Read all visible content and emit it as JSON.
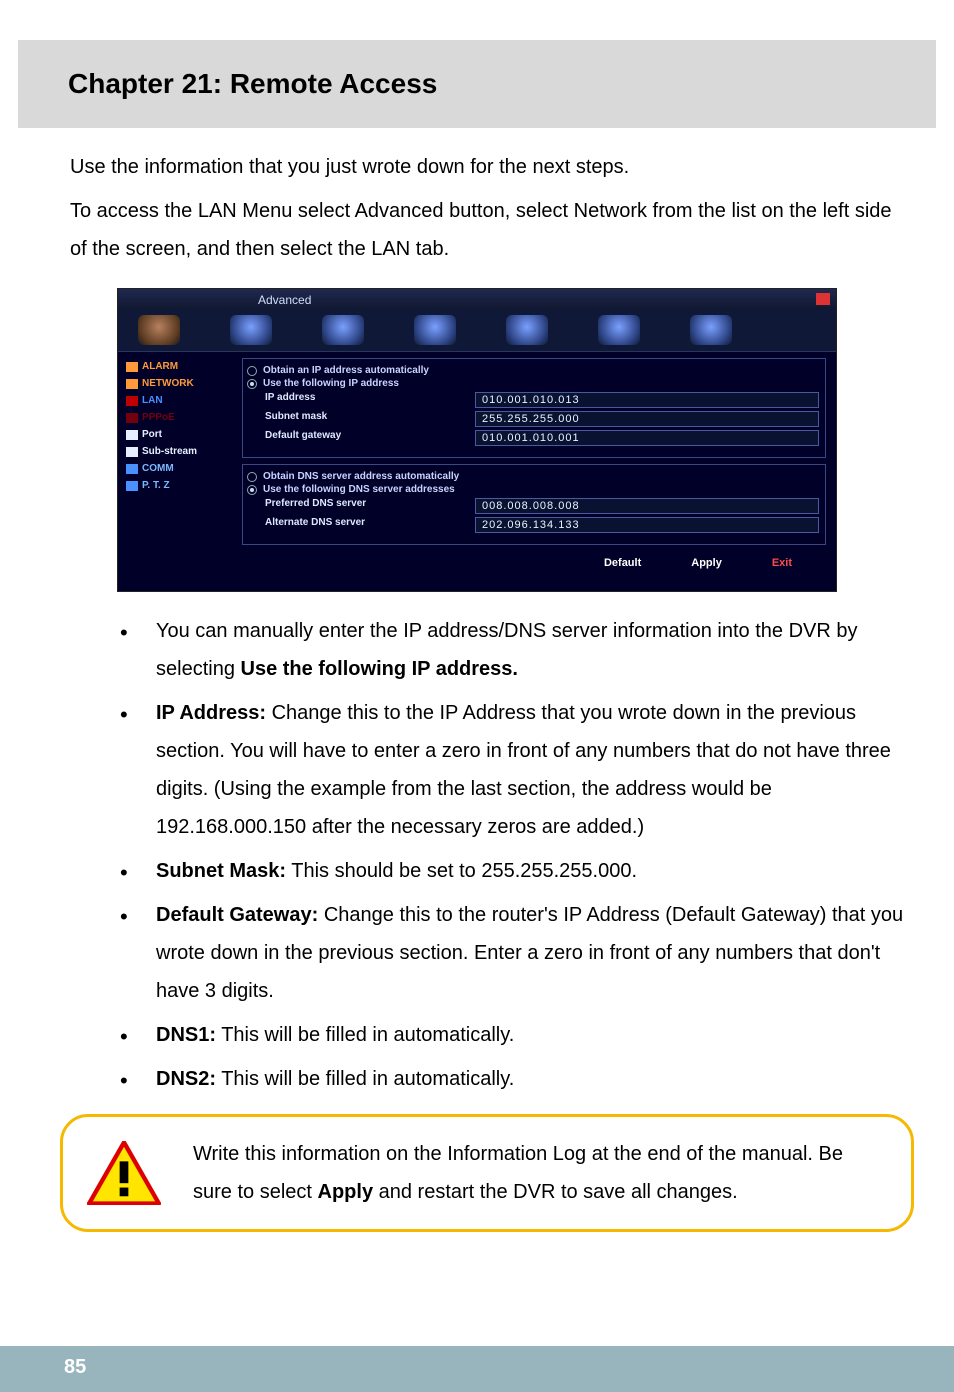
{
  "chapter_title": "Chapter 21: Remote Access",
  "intro": {
    "p1": "Use the information that you just wrote down for the next steps.",
    "p2": "To access the LAN Menu select Advanced button, select Network from the list on the left side of the screen, and then select the LAN tab."
  },
  "screenshot": {
    "window_title": "Advanced",
    "sidebar": {
      "items": [
        {
          "label": "ALARM"
        },
        {
          "label": "NETWORK"
        },
        {
          "label": "LAN"
        },
        {
          "label": "PPPoE"
        },
        {
          "label": "Port"
        },
        {
          "label": "Sub-stream"
        },
        {
          "label": "COMM"
        },
        {
          "label": "P. T. Z"
        }
      ]
    },
    "ip_section": {
      "radio_auto": "Obtain an IP address automatically",
      "radio_manual": "Use the following IP address",
      "rows": {
        "ip_label": "IP address",
        "ip_value": "010.001.010.013",
        "subnet_label": "Subnet mask",
        "subnet_value": "255.255.255.000",
        "gateway_label": "Default gateway",
        "gateway_value": "010.001.010.001"
      }
    },
    "dns_section": {
      "radio_auto": "Obtain DNS server address automatically",
      "radio_manual": "Use the following DNS server addresses",
      "rows": {
        "pref_label": "Preferred DNS server",
        "pref_value": "008.008.008.008",
        "alt_label": "Alternate DNS server",
        "alt_value": "202.096.134.133"
      }
    },
    "buttons": {
      "default": "Default",
      "apply": "Apply",
      "exit": "Exit"
    }
  },
  "bullets": {
    "b1_pre": "You can manually enter the IP address/DNS server information into the DVR by selecting ",
    "b1_bold": "Use the following IP address.",
    "b2_bold": "IP Address:",
    "b2_text": " Change this to the IP Address that you wrote down in the previous section. You will have to enter a zero in front of any numbers that do not have three digits. (Using the example from the last section, the address would be 192.168.000.150 after the necessary zeros are added.)",
    "b3_bold": "Subnet Mask:",
    "b3_text": " This should be set to 255.255.255.000.",
    "b4_bold": "Default Gateway:",
    "b4_text": " Change this to the router's IP Address (Default Gateway) that you wrote down in the previous section. Enter a zero in front of any numbers that don't have 3 digits.",
    "b5_bold": "DNS1:",
    "b5_text": " This will be filled in automatically.",
    "b6_bold": "DNS2:",
    "b6_text": " This will be filled in automatically."
  },
  "callout": {
    "pre": "Write this information on the Information Log at the end of the manual. Be sure to select ",
    "bold": "Apply",
    "post": " and restart the DVR to save all changes."
  },
  "page_number": "85"
}
